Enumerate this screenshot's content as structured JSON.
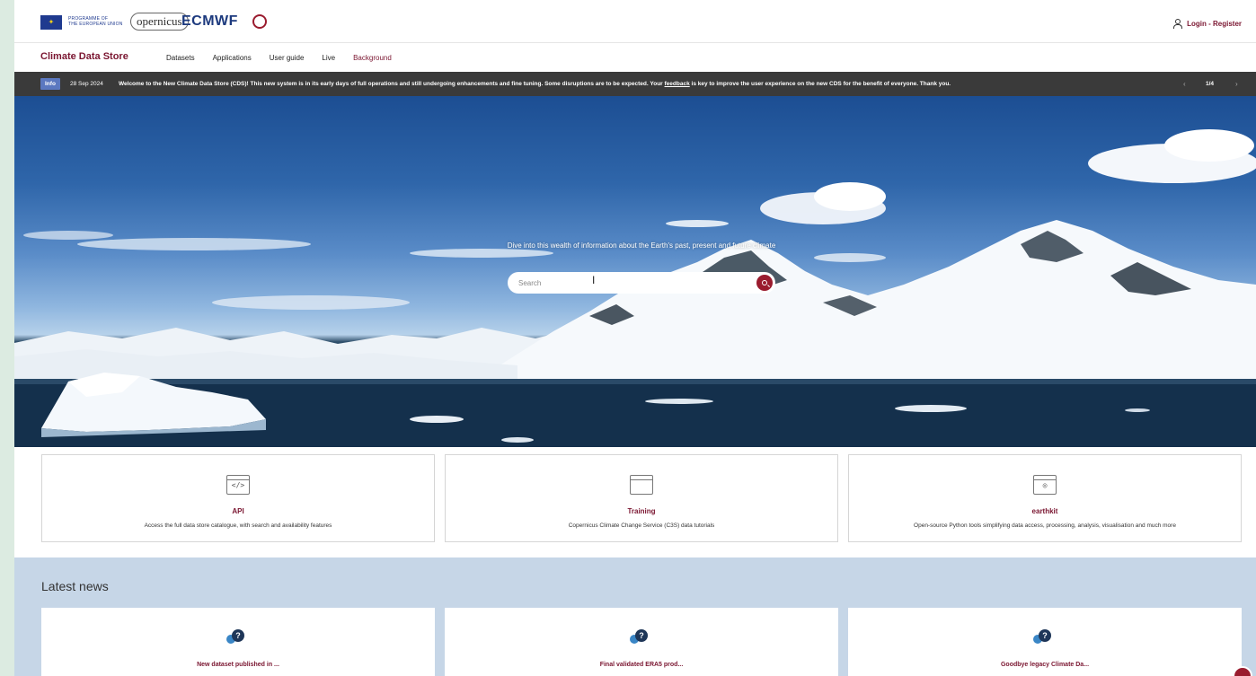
{
  "logos": {
    "eu_text_line1": "PROGRAMME OF",
    "eu_text_line2": "THE EUROPEAN UNION",
    "copernicus": "opernicus",
    "ecmwf": "ECMWF"
  },
  "header": {
    "login_label": "Login - Register"
  },
  "nav": {
    "brand": "Climate Data Store",
    "links": [
      "Datasets",
      "Applications",
      "User guide",
      "Live",
      "Background"
    ]
  },
  "banner": {
    "badge": "Info",
    "date": "28 Sep 2024",
    "message_pre": "Welcome to the New Climate Data Store (CDS)! This new system is in its early days of full operations and still undergoing enhancements and fine tuning. Some disruptions are to be expected. Your ",
    "message_link": "feedback",
    "message_post": " is key to improve the user experience on the new CDS for the benefit of everyone. Thank you.",
    "prev": "‹",
    "count": "1/4",
    "next": "›"
  },
  "hero": {
    "tagline": "Dive into this wealth of information about the Earth's past, present and future climate",
    "search_placeholder": "Search"
  },
  "features": [
    {
      "title": "API",
      "desc": "Access the full data store catalogue, with search and availability features",
      "icon": "code-window-icon",
      "glyph": "</>"
    },
    {
      "title": "Training",
      "desc": "Copernicus Climate Change Service (C3S) data tutorials",
      "icon": "browser-window-icon",
      "glyph": ""
    },
    {
      "title": "earthkit",
      "desc": "Open-source Python tools simplifying data access, processing, analysis, visualisation and much more",
      "icon": "toolkit-window-icon",
      "glyph": "◎"
    }
  ],
  "news": {
    "heading": "Latest news",
    "items": [
      {
        "title": "New dataset published in ...",
        "icon": "news-question-icon",
        "glyph": "?"
      },
      {
        "title": "Final validated ERA5 prod...",
        "icon": "news-question-icon",
        "glyph": "?"
      },
      {
        "title": "Goodbye legacy Climate Da...",
        "icon": "news-question-icon",
        "glyph": "?"
      }
    ]
  },
  "colors": {
    "brand": "#7a1530",
    "accent": "#9a1b2e",
    "banner_bg": "#3a3a3a",
    "news_bg": "#c6d6e7"
  }
}
